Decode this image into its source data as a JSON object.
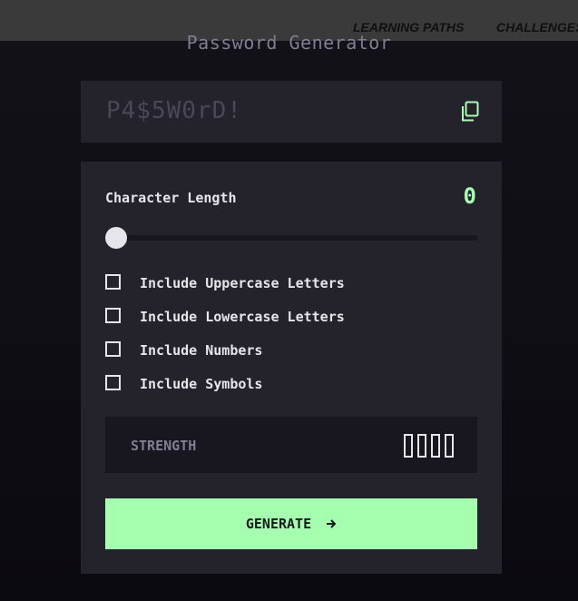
{
  "nav": {
    "links": [
      {
        "label": "LEARNING PATHS"
      },
      {
        "label": "CHALLENGES"
      }
    ]
  },
  "app": {
    "title": "Password Generator"
  },
  "output": {
    "placeholder": "P4$5W0rD!",
    "copy_icon": "copy-icon"
  },
  "length": {
    "label": "Character Length",
    "value": "0",
    "slider_fraction": 0
  },
  "options": [
    {
      "label": "Include Uppercase Letters",
      "checked": false
    },
    {
      "label": "Include Lowercase Letters",
      "checked": false
    },
    {
      "label": "Include Numbers",
      "checked": false
    },
    {
      "label": "Include Symbols",
      "checked": false
    }
  ],
  "strength": {
    "label": "STRENGTH",
    "bars_filled": 0,
    "bars_total": 4
  },
  "generate": {
    "label": "GENERATE",
    "icon": "arrow-right-icon"
  },
  "colors": {
    "accent": "#a4ffaf",
    "panel": "#24232c",
    "dark": "#18171f",
    "muted": "#817d92",
    "text": "#e6e5ea"
  }
}
